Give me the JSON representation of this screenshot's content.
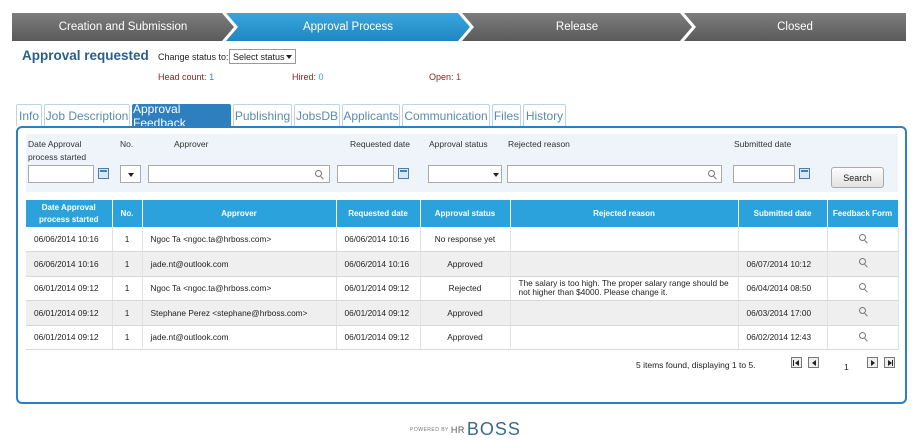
{
  "steps": [
    "Creation and Submission",
    "Approval Process",
    "Release",
    "Closed"
  ],
  "header": {
    "title": "Approval requested",
    "change_status_label": "Change status to:",
    "status_select": "Select status",
    "headcount_label": "Head count:",
    "headcount": "1",
    "hired_label": "Hired:",
    "hired": "0",
    "open_label": "Open:",
    "open": "1"
  },
  "tabs": [
    "Info",
    "Job Description",
    "Approval Feedback",
    "Publishing",
    "JobsDB",
    "Applicants",
    "Communication",
    "Files",
    "History"
  ],
  "active_tab": "Approval Feedback",
  "filters": {
    "date_label": "Date Approval process started",
    "no_label": "No.",
    "approver_label": "Approver",
    "requested_label": "Requested date",
    "status_label": "Approval status",
    "rejected_label": "Rejected reason",
    "submitted_label": "Submitted date",
    "search_button": "Search"
  },
  "table": {
    "headers": [
      "Date Approval process started",
      "No.",
      "Approver",
      "Requested date",
      "Approval status",
      "Rejected reason",
      "Submitted date",
      "Feedback Form"
    ],
    "rows": [
      [
        "06/06/2014 10:16",
        "1",
        "Ngoc Ta <ngoc.ta@hrboss.com>",
        "06/06/2014 10:16",
        "No response yet",
        "",
        ""
      ],
      [
        "06/06/2014 10:16",
        "1",
        "jade.nt@outlook.com",
        "06/06/2014 10:16",
        "Approved",
        "",
        "06/07/2014 10:12"
      ],
      [
        "06/01/2014 09:12",
        "1",
        "Ngoc Ta <ngoc.ta@hrboss.com>",
        "06/01/2014 09:12",
        "Rejected",
        "The salary is too high. The proper salary range should be not higher than $4000. Please change it.",
        "06/04/2014 08:50"
      ],
      [
        "06/01/2014 09:12",
        "1",
        "Stephane Perez <stephane@hrboss.com>",
        "06/01/2014 09:12",
        "Approved",
        "",
        "06/03/2014 17:00"
      ],
      [
        "06/01/2014 09:12",
        "1",
        "jade.nt@outlook.com",
        "06/01/2014 09:12",
        "Approved",
        "",
        "06/02/2014 12:43"
      ]
    ]
  },
  "pager": {
    "summary": "5 items found, displaying 1 to 5.",
    "page": "1"
  },
  "footer": {
    "powered": "POWERED BY",
    "hr": "HR",
    "boss": "BOSS"
  },
  "icons": [
    "calendar-icon",
    "search-icon",
    "dropdown-arrow-icon",
    "first-page-icon",
    "prev-page-icon",
    "next-page-icon",
    "last-page-icon"
  ]
}
